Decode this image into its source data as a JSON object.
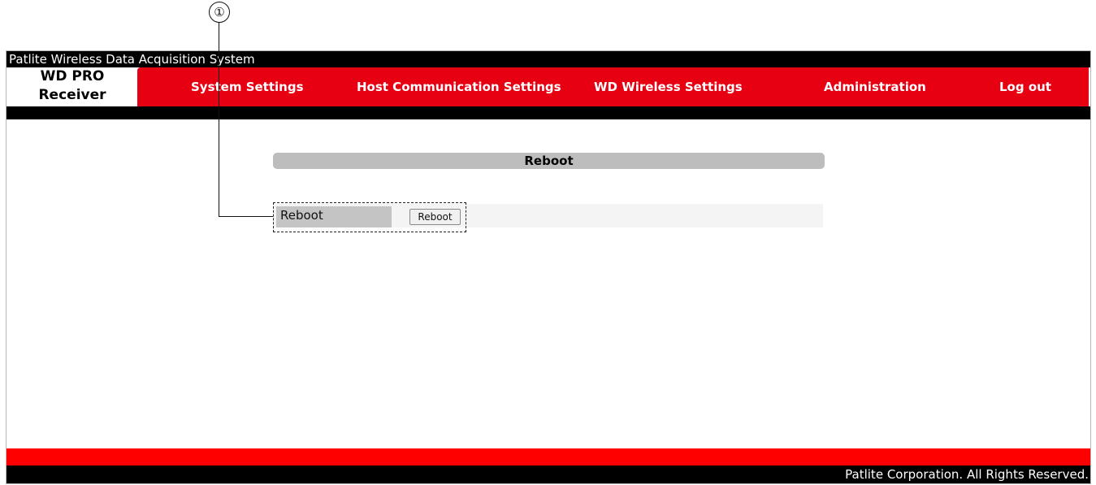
{
  "callout": {
    "number": "①"
  },
  "header": {
    "system_title": "Patlite Wireless Data Acquisition System",
    "brand_line1": "WD PRO",
    "brand_line2": "Receiver",
    "accent_color": "#e60012"
  },
  "nav": [
    {
      "label": "System Settings"
    },
    {
      "label": "Host Communication Settings"
    },
    {
      "label": "WD Wireless Settings"
    },
    {
      "label": "Administration"
    },
    {
      "label": "Log out"
    }
  ],
  "main": {
    "section_title": "Reboot",
    "row_label": "Reboot",
    "reboot_button_label": "Reboot"
  },
  "footer": {
    "copyright": "Patlite Corporation. All Rights Reserved."
  }
}
